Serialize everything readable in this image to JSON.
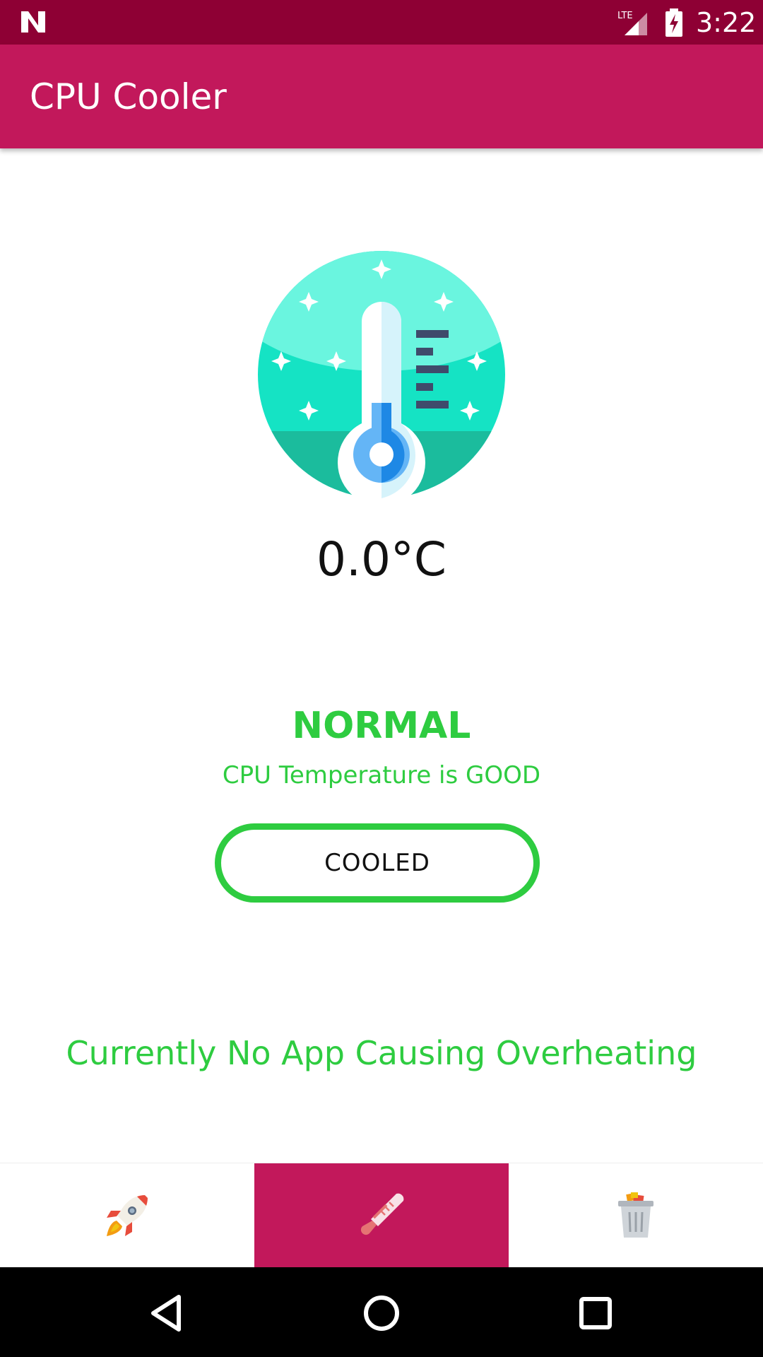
{
  "status_bar": {
    "time": "3:22",
    "network_label": "LTE",
    "icons": [
      "n-logo-icon",
      "lte-signal-icon",
      "battery-charging-icon"
    ]
  },
  "app_bar": {
    "title": "CPU Cooler"
  },
  "main": {
    "illustration_icon": "thermometer-snow-icon",
    "temperature": "0.0°C",
    "status_title": "NORMAL",
    "status_subtitle": "CPU Temperature is GOOD",
    "cooled_button_label": "COOLED",
    "overheating_message": "Currently No App Causing Overheating"
  },
  "bottom_nav": {
    "tabs": [
      {
        "icon": "rocket-icon",
        "active": false
      },
      {
        "icon": "thermometer-icon",
        "active": true
      },
      {
        "icon": "trash-bin-icon",
        "active": false
      }
    ]
  },
  "system_nav": {
    "icons": [
      "back-icon",
      "home-icon",
      "recents-icon"
    ]
  },
  "colors": {
    "status_bar": "#8e0034",
    "app_bar": "#c2185b",
    "accent_green": "#2ecc40",
    "active_tab": "#c2185b"
  }
}
